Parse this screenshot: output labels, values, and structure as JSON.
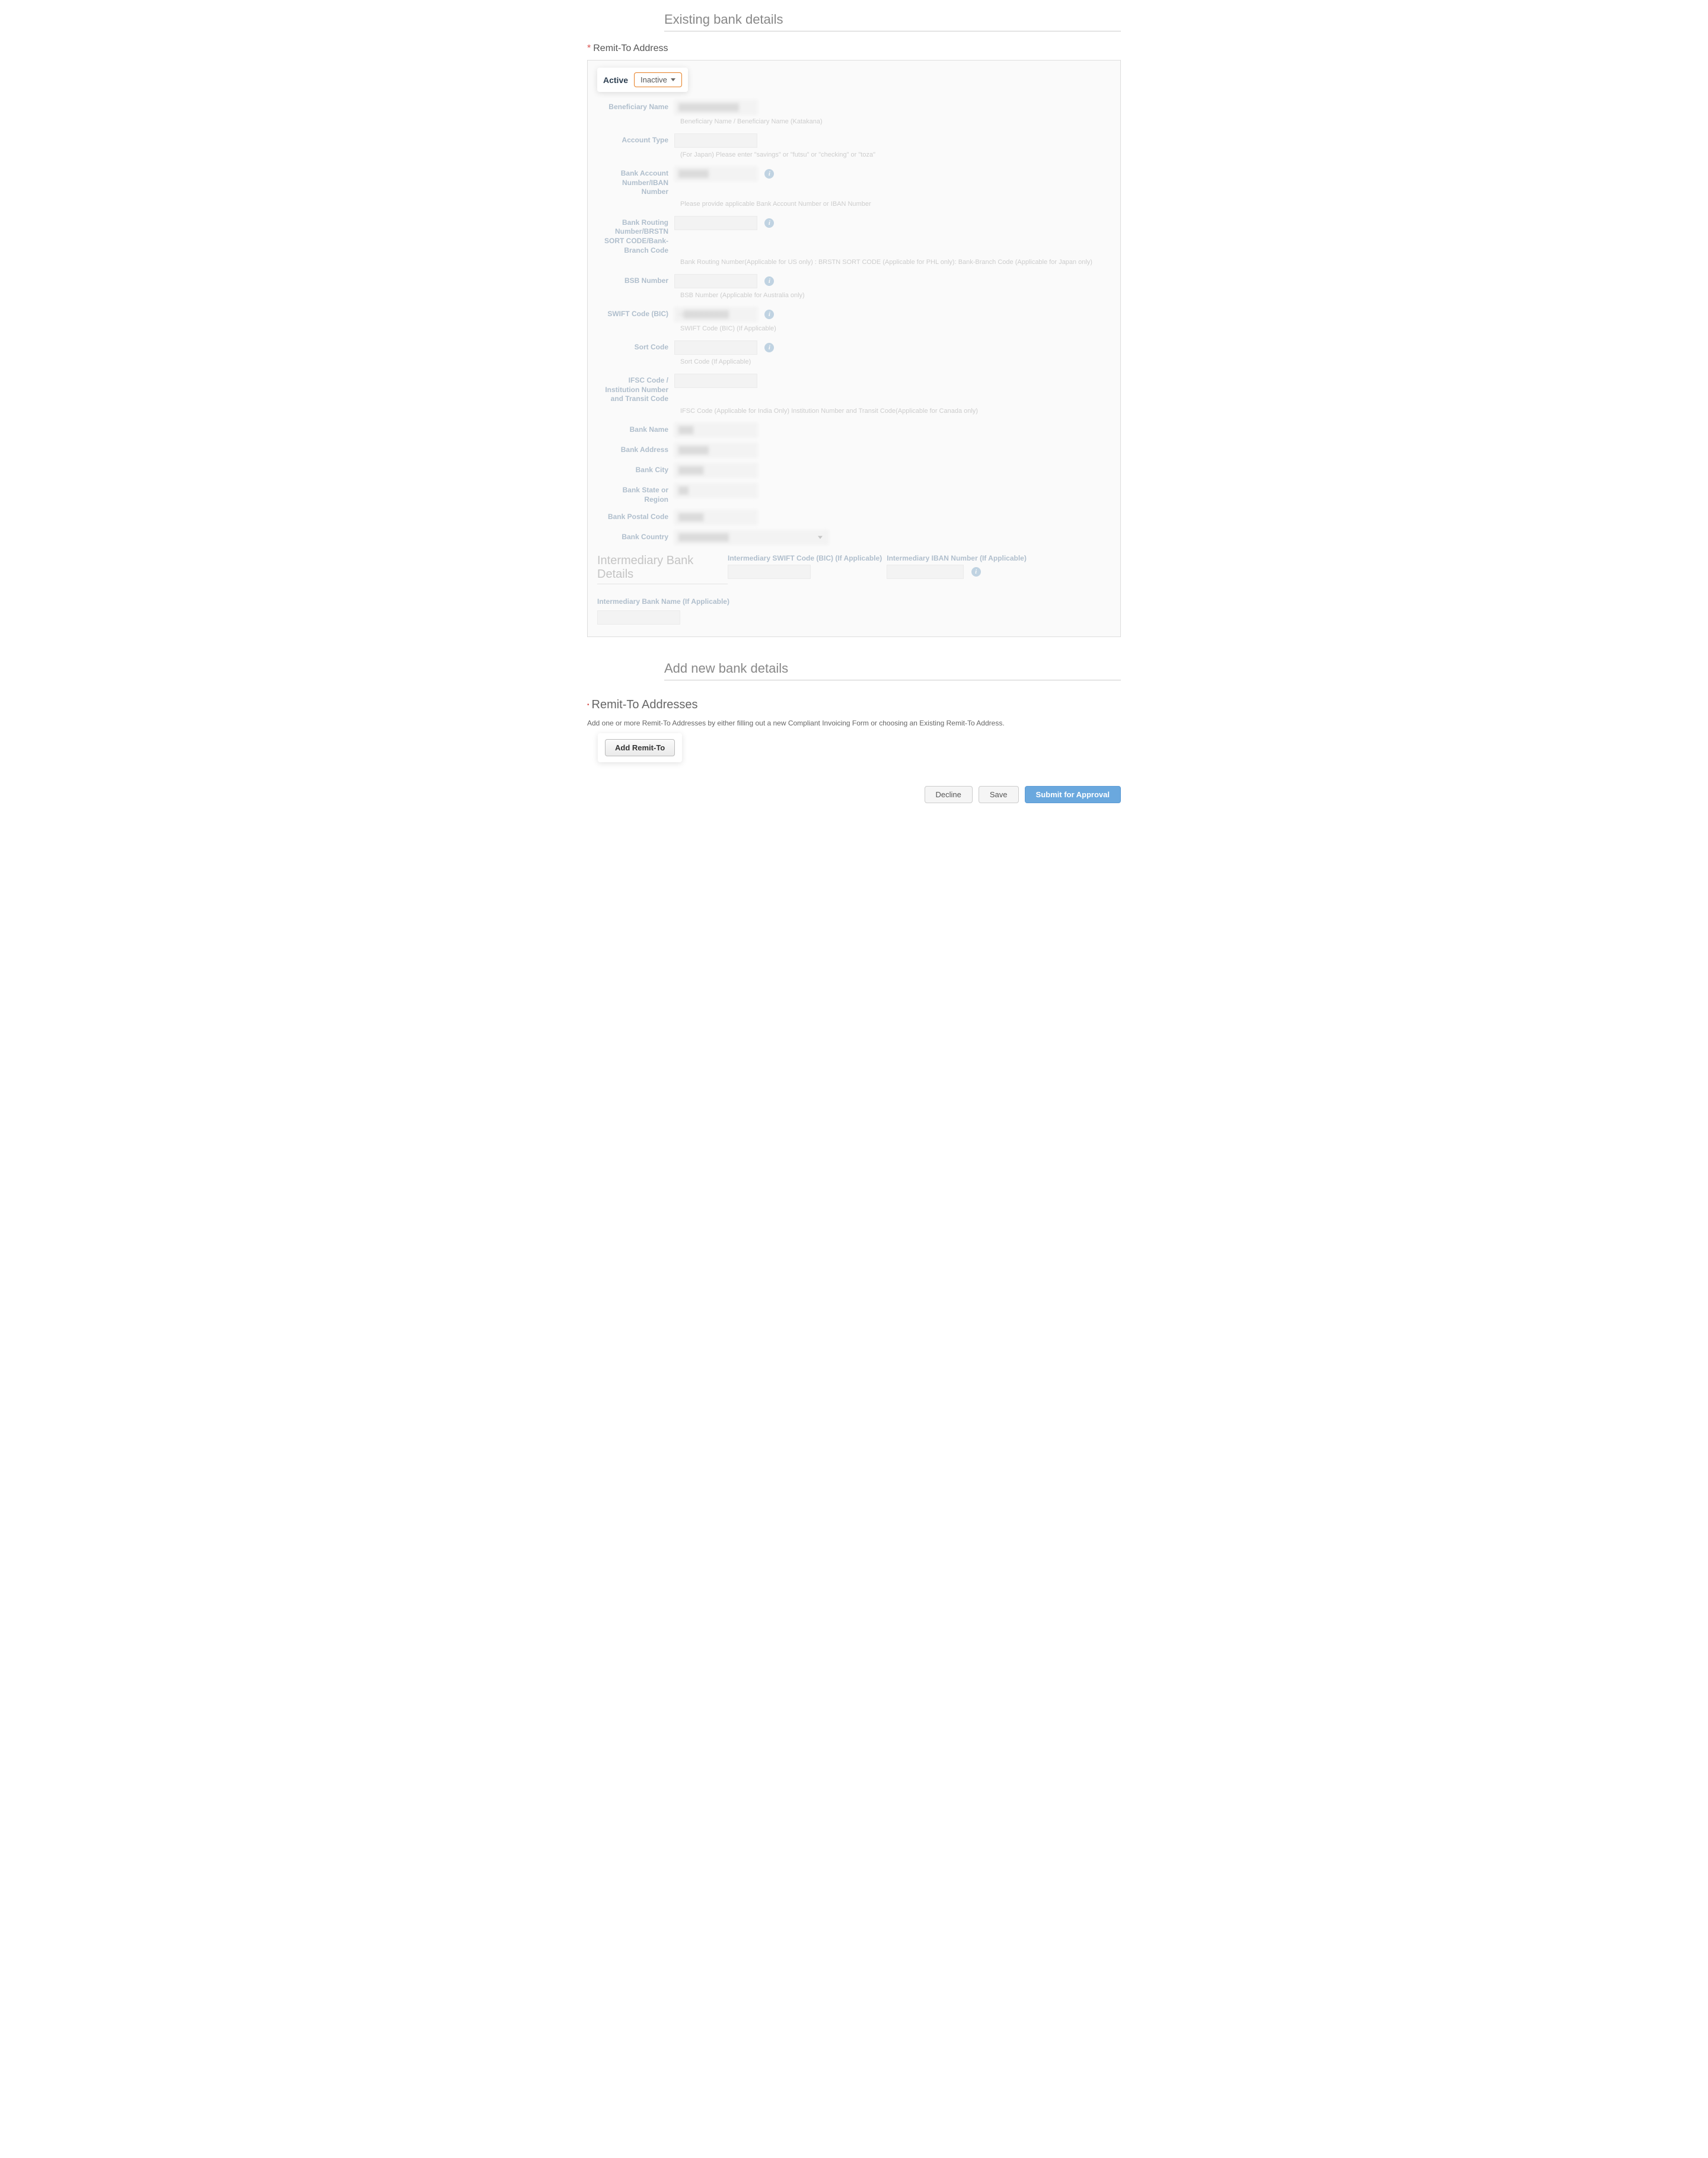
{
  "existing_bank": {
    "header": "Existing bank details",
    "remit_label": "Remit-To Address",
    "tabs": {
      "active": "Active",
      "inactive": "Inactive"
    },
    "fields": {
      "beneficiary_name": {
        "label": "Beneficiary Name",
        "value": "████████████",
        "helper": "Beneficiary Name / Beneficiary Name (Katakana)"
      },
      "account_type": {
        "label": "Account Type",
        "value": "",
        "helper": "(For Japan) Please enter \"savings\" or \"futsu\" or \"checking\" or \"toza\""
      },
      "bank_account_number": {
        "label": "Bank Account Number/IBAN Number",
        "value": "██████",
        "helper": "Please provide applicable Bank Account Number or IBAN Number"
      },
      "routing": {
        "label": "Bank Routing Number/BRSTN SORT CODE/Bank-Branch Code",
        "value": "",
        "helper": "Bank Routing Number(Applicable for US only) : BRSTN SORT CODE (Applicable for PHL only): Bank-Branch Code (Applicable for Japan only)"
      },
      "bsb": {
        "label": "BSB Number",
        "value": "",
        "helper": "BSB Number (Applicable for Australia only)"
      },
      "swift": {
        "label": "SWIFT Code (BIC)",
        "value": "H█████████",
        "helper": "SWIFT Code (BIC) (If Applicable)"
      },
      "sort_code": {
        "label": "Sort Code",
        "value": "",
        "helper": "Sort Code (If Applicable)"
      },
      "ifsc": {
        "label": "IFSC Code / Institution Number and Transit Code",
        "value": "",
        "helper": "IFSC Code (Applicable for India Only) Institution Number and Transit Code(Applicable for Canada only)"
      },
      "bank_name": {
        "label": "Bank Name",
        "value": "███"
      },
      "bank_address": {
        "label": "Bank Address",
        "value": "██████"
      },
      "bank_city": {
        "label": "Bank City",
        "value": "█████"
      },
      "bank_state": {
        "label": "Bank State or Region",
        "value": "██"
      },
      "bank_postal": {
        "label": "Bank Postal Code",
        "value": "█████"
      },
      "bank_country": {
        "label": "Bank Country",
        "value": "██████████"
      }
    },
    "intermediary": {
      "header": "Intermediary Bank Details",
      "swift_label": "Intermediary SWIFT Code (BIC) (If Applicable)",
      "iban_label": "Intermediary IBAN Number (If Applicable)",
      "name_label": "Intermediary Bank Name (If Applicable)"
    }
  },
  "add_new": {
    "header": "Add new bank details",
    "remit_header": "Remit-To Addresses",
    "desc": "Add one or more Remit-To Addresses by either filling out a new Compliant Invoicing Form or choosing an Existing Remit-To Address.",
    "add_btn": "Add Remit-To"
  },
  "footer": {
    "decline": "Decline",
    "save": "Save",
    "submit": "Submit for Approval"
  },
  "info_glyph": "i"
}
